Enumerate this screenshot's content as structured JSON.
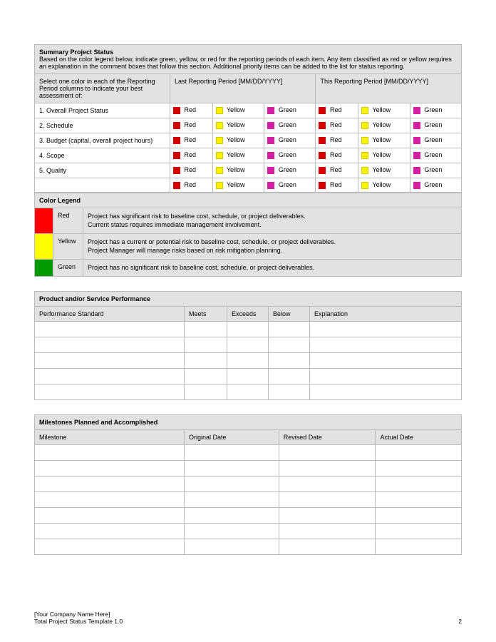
{
  "summary": {
    "title": "Summary Project Status",
    "description": "Based on the color legend below, indicate green, yellow, or red for the reporting periods of each item. Any item classified as red or yellow requires an explanation in the comment boxes that follow this section. Additional priority items can be added to the list for status reporting.",
    "selectInstruction": "Select one color in each of the Reporting Period columns to indicate your best assessment of:",
    "lastPeriod": "Last Reporting Period [MM/DD/YYYY]",
    "thisPeriod": "This Reporting Period [MM/DD/YYYY]",
    "rows": [
      "1. Overall Project Status",
      "2. Schedule",
      "3. Budget (capital, overall project hours)",
      "4. Scope",
      "5. Quality",
      ""
    ],
    "redLabel": "Red",
    "yellowLabel": "Yellow",
    "greenLabel": "Green"
  },
  "legend": {
    "title": "Color Legend",
    "items": [
      {
        "label": "Red",
        "desc": "Project has significant risk to baseline cost, schedule, or project deliverables.\nCurrent status requires immediate management involvement."
      },
      {
        "label": "Yellow",
        "desc": "Project has a current or potential risk to baseline cost, schedule, or project deliverables.\nProject Manager will manage risks based on risk mitigation planning."
      },
      {
        "label": "Green",
        "desc": "Project has no significant risk to baseline cost, schedule, or project deliverables."
      }
    ]
  },
  "performance": {
    "title": "Product and/or Service Performance",
    "headers": [
      "Performance Standard",
      "Meets",
      "Exceeds",
      "Below",
      "Explanation"
    ]
  },
  "milestones": {
    "title": "Milestones Planned and Accomplished",
    "headers": [
      "Milestone",
      "Original Date",
      "Revised Date",
      "Actual Date"
    ]
  },
  "footer": {
    "company": "[Your Company Name Here]",
    "template": "Total Project Status Template 1.0",
    "page": "2"
  }
}
